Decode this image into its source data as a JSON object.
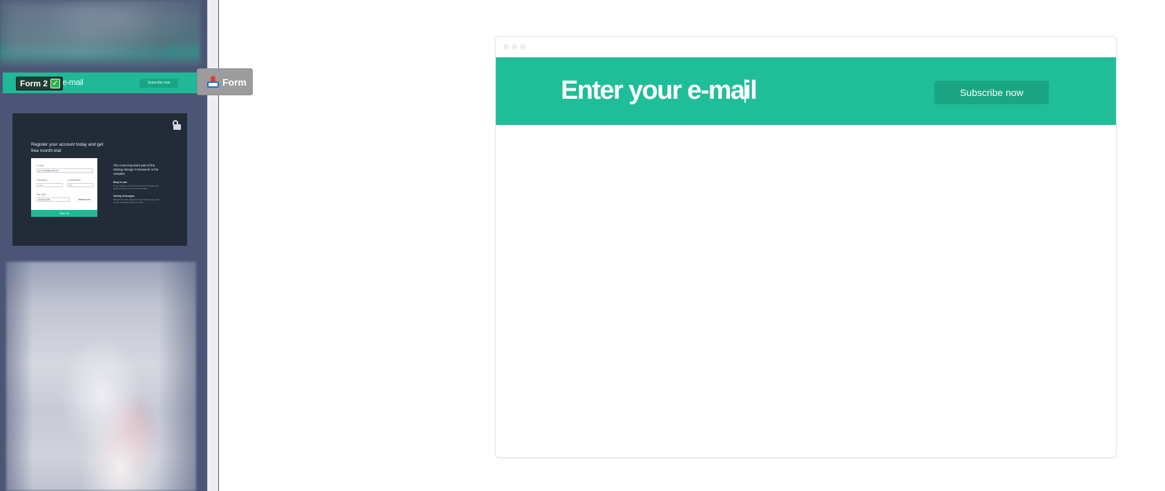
{
  "sidebar": {
    "active_block": {
      "label": "Form 2",
      "check": "✓",
      "preview_title": "e-mail",
      "preview_button": "Subscribe now"
    },
    "dragged_chip": {
      "icon": "stamp-icon",
      "label": "Form"
    },
    "dark_block": {
      "icon": "unlock-icon",
      "headline": "Register your account today and get free month trial",
      "form": {
        "email_label": "E-mail",
        "email_value": "jon.ivanik@gmail.com",
        "password_label": "Password",
        "password_value": "•••••",
        "confirmation_label": "Confirmation",
        "confirmation_value": "•••••",
        "site_label": "Site URL",
        "site_value": "Designmodo",
        "site_suffix": "startup.com",
        "submit": "Sign Up"
      },
      "side": {
        "title": "The most important part of the Startup Design Framework is the samples",
        "feature1_title": "Easy to use",
        "feature1_text": "To get started, you import the desired sample and apply the layout of 21 useful samples.",
        "feature2_title": "Variety of designs",
        "feature2_text": "Responsive web design is a new design approach aimed at crafting sites to provide"
      }
    }
  },
  "canvas": {
    "hero": {
      "title": "Enter your e-mail",
      "button": "Subscribe now",
      "background": "#1fbe99",
      "button_color": "#1aa683"
    }
  }
}
